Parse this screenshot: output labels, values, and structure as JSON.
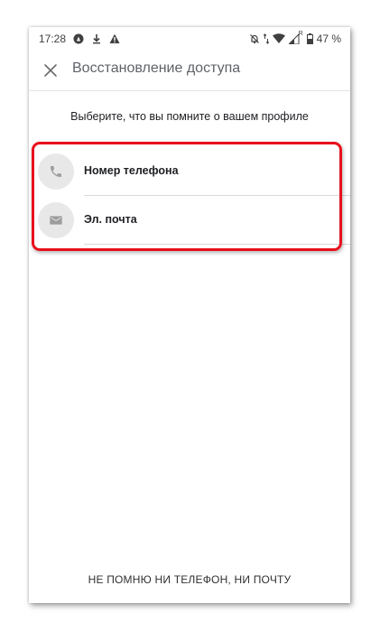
{
  "status_bar": {
    "time": "17:28",
    "battery_percent": "47 %",
    "left_icons": [
      "assistant-icon",
      "download-icon",
      "warning-icon"
    ],
    "right_icons": [
      "alarm-off-icon",
      "data-arrows-icon",
      "wifi-icon",
      "signal-icon",
      "battery-icon"
    ],
    "roaming_label": "R"
  },
  "app_bar": {
    "title": "Восстановление доступа",
    "close_icon": "close-icon"
  },
  "prompt": "Выберите, что вы помните о вашем профиле",
  "options": [
    {
      "label": "Номер телефона",
      "icon": "phone-icon"
    },
    {
      "label": "Эл. почта",
      "icon": "mail-icon"
    }
  ],
  "bottom_link": "НЕ ПОМНЮ НИ ТЕЛЕФОН, НИ ПОЧТУ",
  "colors": {
    "highlight": "#e8101c",
    "icon_circle": "#e8e8e8",
    "icon_glyph": "#9e9e9e",
    "title": "#5f6368"
  }
}
